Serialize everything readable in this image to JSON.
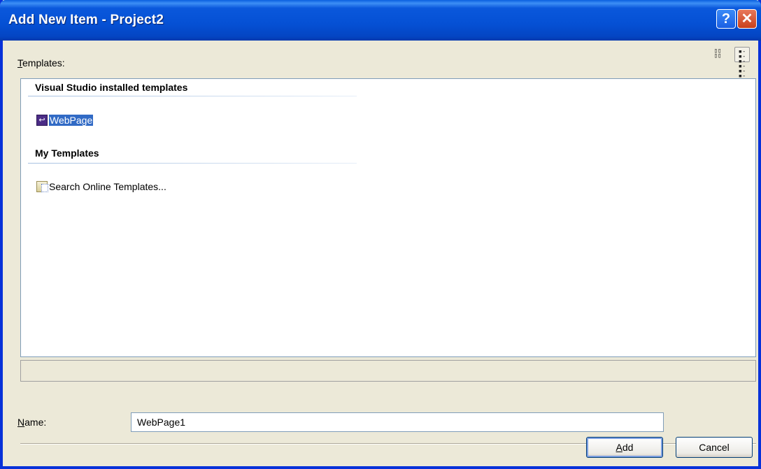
{
  "window": {
    "title": "Add New Item - Project2",
    "help_button": "?",
    "close_button": "✕"
  },
  "templates_label": "Templates:",
  "view_icons": [
    "large-icons-view-icon",
    "small-icons-view-icon"
  ],
  "groups": [
    {
      "title": "Visual Studio installed templates",
      "items": [
        {
          "label": "WebPage",
          "icon": "webpage-icon",
          "selected": true
        }
      ]
    },
    {
      "title": "My Templates",
      "items": [
        {
          "label": "Search Online Templates...",
          "icon": "search-online-icon",
          "selected": false
        }
      ]
    }
  ],
  "description": "",
  "name_label": "Name:",
  "name_value": "WebPage1",
  "buttons": {
    "add": "Add",
    "cancel": "Cancel"
  },
  "colors": {
    "titlebar": "#0550d4",
    "selection": "#316ac5",
    "dialog_bg": "#ece9d8"
  }
}
